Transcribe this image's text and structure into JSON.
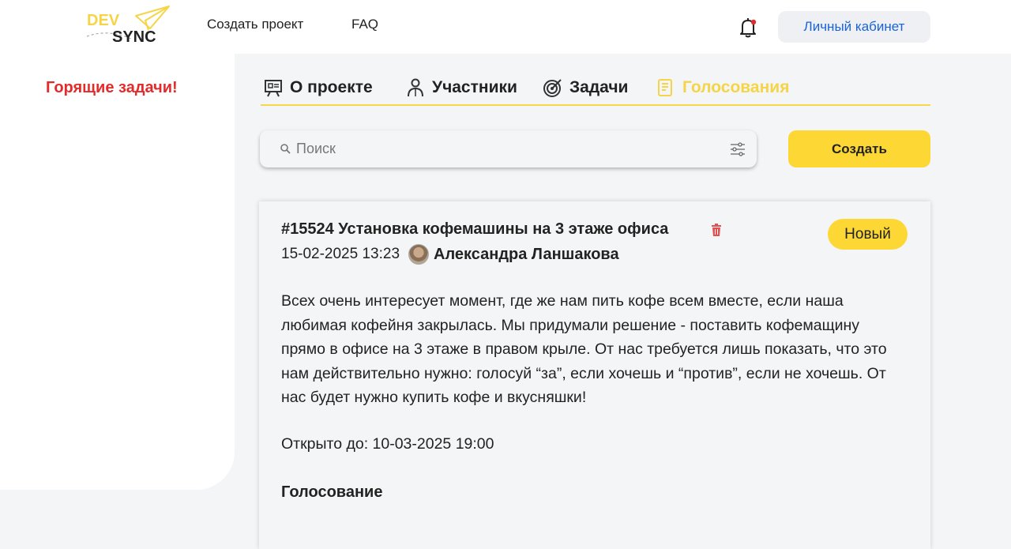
{
  "header": {
    "logo_text_top": "DEV",
    "logo_text_bottom": "SYNC",
    "nav": [
      {
        "label": "Создать проект"
      },
      {
        "label": "FAQ"
      }
    ],
    "account_label": "Личный кабинет",
    "has_unread_notifications": true
  },
  "sidebar": {
    "hot_tasks_label": "Горящие задачи!"
  },
  "tabs": [
    {
      "label": "О проекте",
      "icon": "presentation-icon",
      "active": false
    },
    {
      "label": "Участники",
      "icon": "team-icon",
      "active": false
    },
    {
      "label": "Задачи",
      "icon": "target-icon",
      "active": false
    },
    {
      "label": "Голосования",
      "icon": "ballot-icon",
      "active": true
    }
  ],
  "search": {
    "placeholder": "Поиск",
    "value": ""
  },
  "create_label": "Создать",
  "poll": {
    "title": "#15524 Установка кофемашины на 3 этаже офиса",
    "status": "Новый",
    "date": "15-02-2025 13:23",
    "author": "Александра Ланшакова",
    "description": "Всех очень интересует момент, где же нам пить кофе всем вместе, если наша любимая кофейня закрылась. Мы придумали решение - поставить кофемащину прямо в офисе на 3 этаже в правом крыле. От нас требуется лишь показать, что это нам действительно нужно: голосуй “за”, если хочешь и “против”, если не хочешь. От нас будет нужно купить кофе и вкусняшки!",
    "open_until": "Открыто до: 10-03-2025 19:00",
    "voting_heading": "Голосование"
  },
  "colors": {
    "accent_yellow": "#fdd835",
    "hot_red": "#e32b2b",
    "link_blue": "#1a64d6",
    "background": "#f4f5f7"
  }
}
